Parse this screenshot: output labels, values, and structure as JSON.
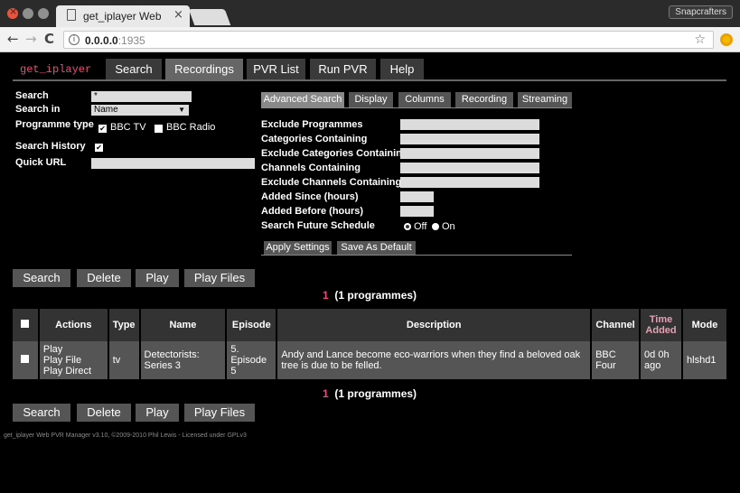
{
  "browser": {
    "tab_title": "get_iplayer Web PV",
    "profile_label": "Snapcrafters",
    "url_host": "0.0.0.0",
    "url_port": ":1935"
  },
  "nav": {
    "brand": "get_iplayer",
    "items": [
      "Search",
      "Recordings",
      "PVR List",
      "Run PVR",
      "Help"
    ],
    "active": "Recordings"
  },
  "search_form": {
    "search_label": "Search",
    "search_value": "*",
    "search_in_label": "Search in",
    "search_in_value": "Name",
    "programme_type_label": "Programme type",
    "bbc_tv_label": "BBC TV",
    "bbc_radio_label": "BBC Radio",
    "search_history_label": "Search History",
    "quick_url_label": "Quick URL",
    "quick_url_value": ""
  },
  "options": {
    "tabs": [
      "Advanced Search",
      "Display",
      "Columns",
      "Recording",
      "Streaming"
    ],
    "active_tab": "Advanced Search",
    "fields": [
      {
        "label": "Exclude Programmes",
        "value": ""
      },
      {
        "label": "Categories Containing",
        "value": ""
      },
      {
        "label": "Exclude Categories Containing",
        "value": ""
      },
      {
        "label": "Channels Containing",
        "value": ""
      },
      {
        "label": "Exclude Channels Containing",
        "value": ""
      },
      {
        "label": "Added Since (hours)",
        "value": ""
      },
      {
        "label": "Added Before (hours)",
        "value": ""
      }
    ],
    "future_label": "Search Future Schedule",
    "future_off": "Off",
    "future_on": "On",
    "future_selected": "Off",
    "apply_label": "Apply Settings",
    "save_default_label": "Save As Default"
  },
  "actions": {
    "search": "Search",
    "delete": "Delete",
    "play": "Play",
    "play_files": "Play Files"
  },
  "results": {
    "count": "1",
    "count_label": "(1 programmes)",
    "columns": [
      "Actions",
      "Type",
      "Name",
      "Episode",
      "Description",
      "Channel",
      "Time Added",
      "Mode"
    ],
    "rows": [
      {
        "actions": [
          "Play",
          "Play File",
          "Play Direct"
        ],
        "type": "tv",
        "name": "Detectorists: Series 3",
        "episode": "5. Episode 5",
        "description": "Andy and Lance become eco-warriors when they find a beloved oak tree is due to be felled.",
        "channel": "BBC Four",
        "time_added": "0d 0h ago",
        "mode": "hlshd1"
      }
    ]
  },
  "footer": "get_iplayer Web PVR Manager v3.10, ©2009-2010 Phil Lewis - Licensed under GPLv3"
}
